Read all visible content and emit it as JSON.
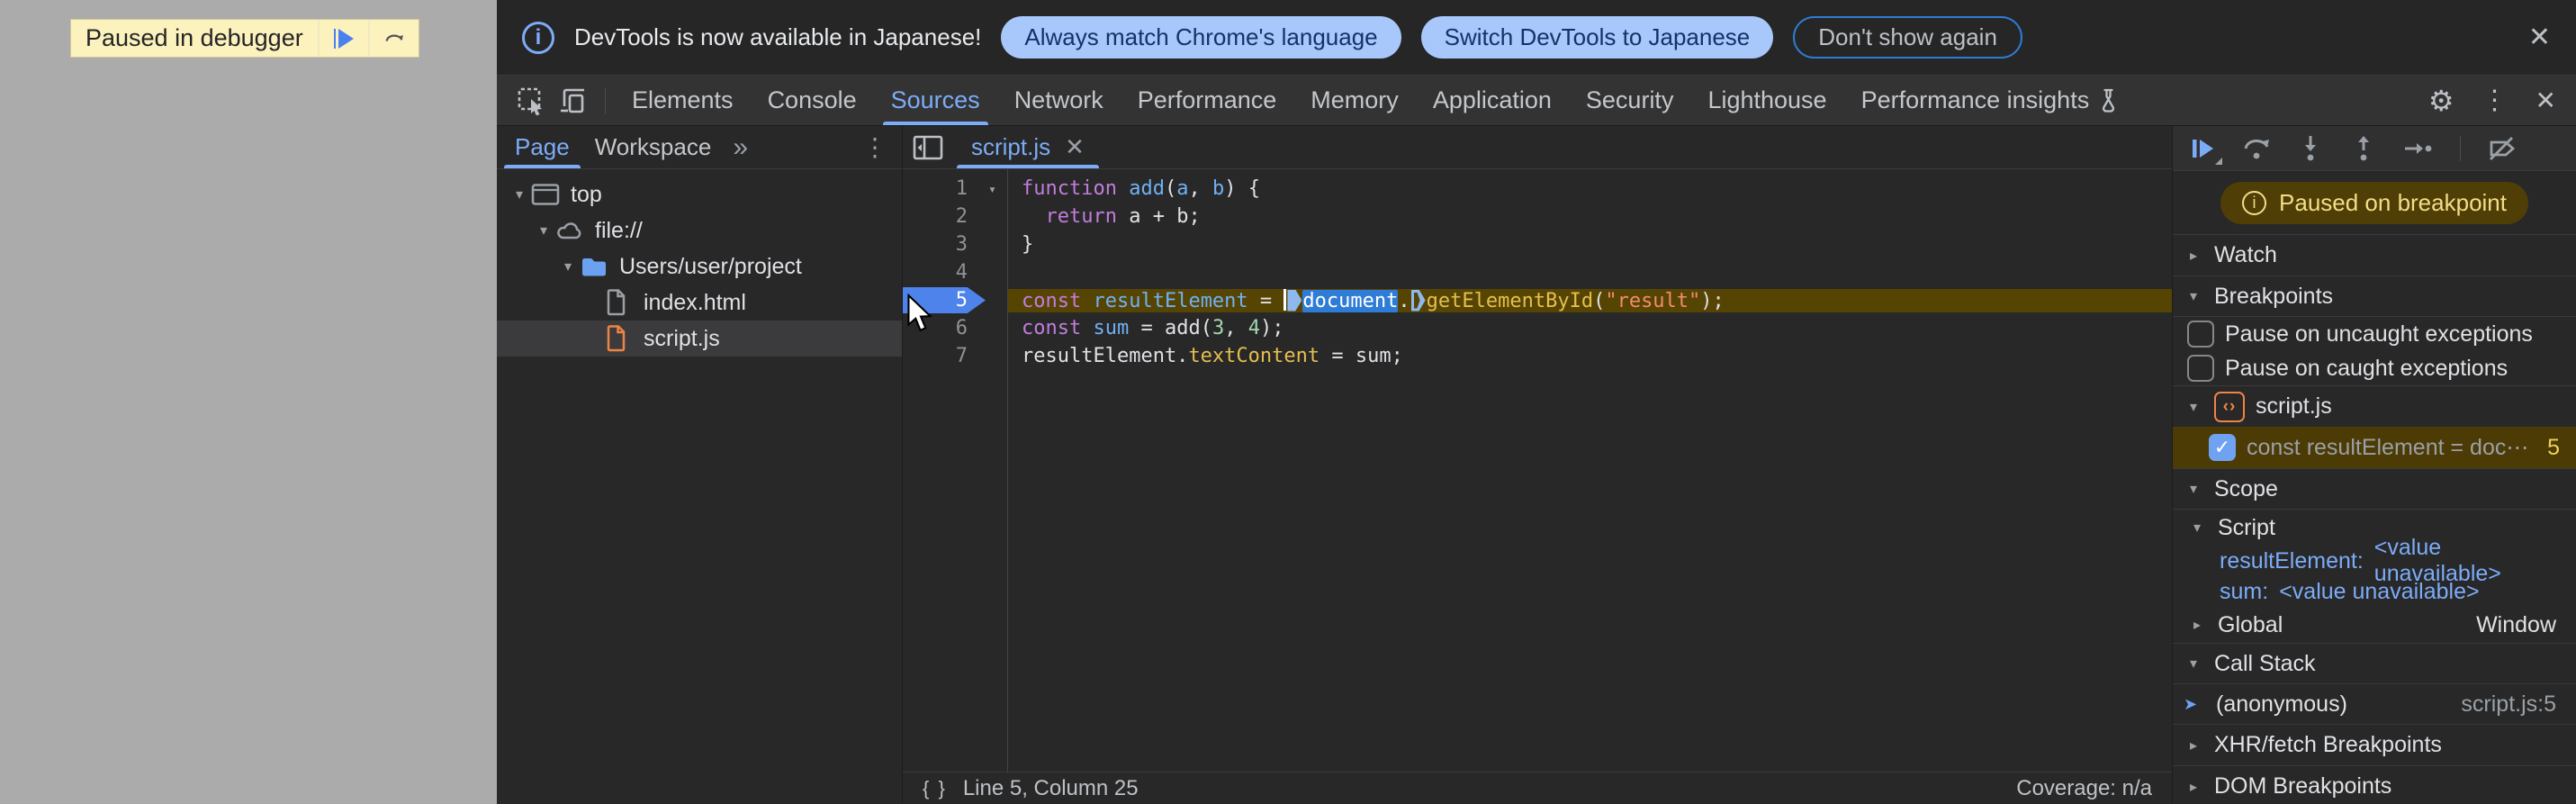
{
  "colors": {
    "accent_blue": "#7cacf8",
    "page_gray": "#ababab",
    "paused_bar_yellow": "#fbf2bd",
    "infobar_button_bg": "#a8c7fa",
    "infobar_button_text": "#14336b",
    "outline_button_border": "#2d7dd2",
    "exec_line_bg": "#564403",
    "breakpoint_flag_blue": "#4e83ec",
    "selection_blue": "#2f7cd6",
    "paused_badge_bg": "#4f3e06",
    "paused_badge_text": "#f4dd86",
    "breakpoint_row_bg": "#4d3b05",
    "keyword": "#c17ddd",
    "variable": "#6fb1f5",
    "property": "#e5bf4e",
    "string": "#f28b6e",
    "number": "#a5d6b0",
    "orange_file": "#ee8445",
    "folder_blue": "#6aa1f0"
  },
  "glyphs": {
    "gear": "⚙",
    "menu_dots": "⋮",
    "close": "✕",
    "more_tabs": "»",
    "braces": "{ }",
    "check": "✓",
    "info": "i",
    "tri_down": "▾",
    "tri_right": "▸"
  },
  "page": {
    "paused_label": "Paused in debugger"
  },
  "infobar": {
    "message": "DevTools is now available in Japanese!",
    "buttons": [
      "Always match Chrome's language",
      "Switch DevTools to Japanese",
      "Don't show again"
    ]
  },
  "toolbar": {
    "selected": "Sources",
    "tabs": [
      {
        "label": "Elements"
      },
      {
        "label": "Console"
      },
      {
        "label": "Sources"
      },
      {
        "label": "Network"
      },
      {
        "label": "Performance"
      },
      {
        "label": "Memory"
      },
      {
        "label": "Application"
      },
      {
        "label": "Security"
      },
      {
        "label": "Lighthouse"
      },
      {
        "label": "Performance insights",
        "flask": true
      }
    ]
  },
  "navigator": {
    "tabs": [
      {
        "label": "Page",
        "selected": true
      },
      {
        "label": "Workspace",
        "selected": false
      }
    ],
    "tree": [
      {
        "label": "top",
        "icon": "frame",
        "level": 0,
        "expanded": true
      },
      {
        "label": "file://",
        "icon": "cloud",
        "level": 1,
        "expanded": true
      },
      {
        "label": "Users/user/project",
        "icon": "folder",
        "level": 2,
        "expanded": true
      },
      {
        "label": "index.html",
        "icon": "file-gray",
        "level": 3
      },
      {
        "label": "script.js",
        "icon": "file-orange",
        "level": 3,
        "selected": true
      }
    ]
  },
  "editor": {
    "tab_label": "script.js",
    "lines": [
      {
        "n": 1,
        "fold": true,
        "tokens": [
          [
            "kw",
            "function"
          ],
          [
            "pl",
            " "
          ],
          [
            "vr",
            "add"
          ],
          [
            "pl",
            "("
          ],
          [
            "vr",
            "a"
          ],
          [
            "pl",
            ", "
          ],
          [
            "vr",
            "b"
          ],
          [
            "pl",
            ") {"
          ]
        ]
      },
      {
        "n": 2,
        "tokens": [
          [
            "pl",
            "  "
          ],
          [
            "kw",
            "return"
          ],
          [
            "pl",
            " a + b;"
          ]
        ]
      },
      {
        "n": 3,
        "tokens": [
          [
            "pl",
            "}"
          ]
        ]
      },
      {
        "n": 4,
        "tokens": []
      },
      {
        "n": 5,
        "exec": true,
        "tokens": [
          [
            "kw",
            "const"
          ],
          [
            "pl",
            " "
          ],
          [
            "vr",
            "resultElement"
          ],
          [
            "pl",
            " = "
          ],
          [
            "caret",
            ""
          ],
          [
            "marker",
            ""
          ],
          [
            "sel",
            "document"
          ],
          [
            "pl",
            "."
          ],
          [
            "marker2",
            ""
          ],
          [
            "prop",
            "getElementById"
          ],
          [
            "pl",
            "("
          ],
          [
            "str",
            "\"result\""
          ],
          [
            "pl",
            ");"
          ]
        ]
      },
      {
        "n": 6,
        "tokens": [
          [
            "kw",
            "const"
          ],
          [
            "pl",
            " "
          ],
          [
            "vr",
            "sum"
          ],
          [
            "pl",
            " = add("
          ],
          [
            "num",
            "3"
          ],
          [
            "pl",
            ", "
          ],
          [
            "num",
            "4"
          ],
          [
            "pl",
            ");"
          ]
        ]
      },
      {
        "n": 7,
        "tokens": [
          [
            "pl",
            "resultElement."
          ],
          [
            "prop",
            "textContent"
          ],
          [
            "pl",
            " = sum;"
          ]
        ]
      }
    ],
    "status": {
      "left": "Line 5, Column 25",
      "right": "Coverage: n/a"
    }
  },
  "debug_panel": {
    "paused_badge": "Paused on breakpoint",
    "watch": "Watch",
    "breakpoints": "Breakpoints",
    "pause_uncaught": "Pause on uncaught exceptions",
    "pause_caught": "Pause on caught exceptions",
    "bp_group_file": "script.js",
    "bp_entry": {
      "text": "const resultElement = doc⋯",
      "line": "5",
      "checked": true
    },
    "scope": "Scope",
    "scope_script": "Script",
    "scope_vars": [
      {
        "name": "resultElement",
        "value": "<value unavailable>"
      },
      {
        "name": "sum",
        "value": "<value unavailable>"
      }
    ],
    "scope_global": "Global",
    "scope_global_value": "Window",
    "call_stack": "Call Stack",
    "frames": [
      {
        "name": "(anonymous)",
        "location": "script.js:5"
      }
    ],
    "xhr": "XHR/fetch Breakpoints",
    "dom": "DOM Breakpoints"
  }
}
